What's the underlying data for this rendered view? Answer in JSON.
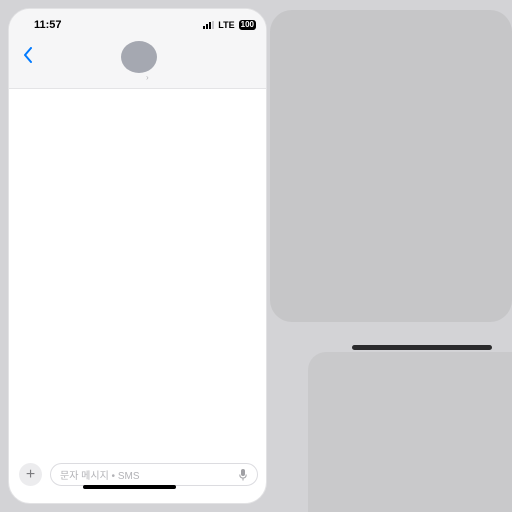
{
  "status_bar": {
    "time": "11:57",
    "network": "LTE",
    "battery": "100"
  },
  "nav": {
    "back_icon": "chevron-left-icon",
    "chevron_glyph": "›"
  },
  "composer": {
    "plus_glyph": "+",
    "placeholder": "문자 메시지 • SMS",
    "mic_icon": "microphone-icon"
  },
  "colors": {
    "accent": "#007aff"
  }
}
